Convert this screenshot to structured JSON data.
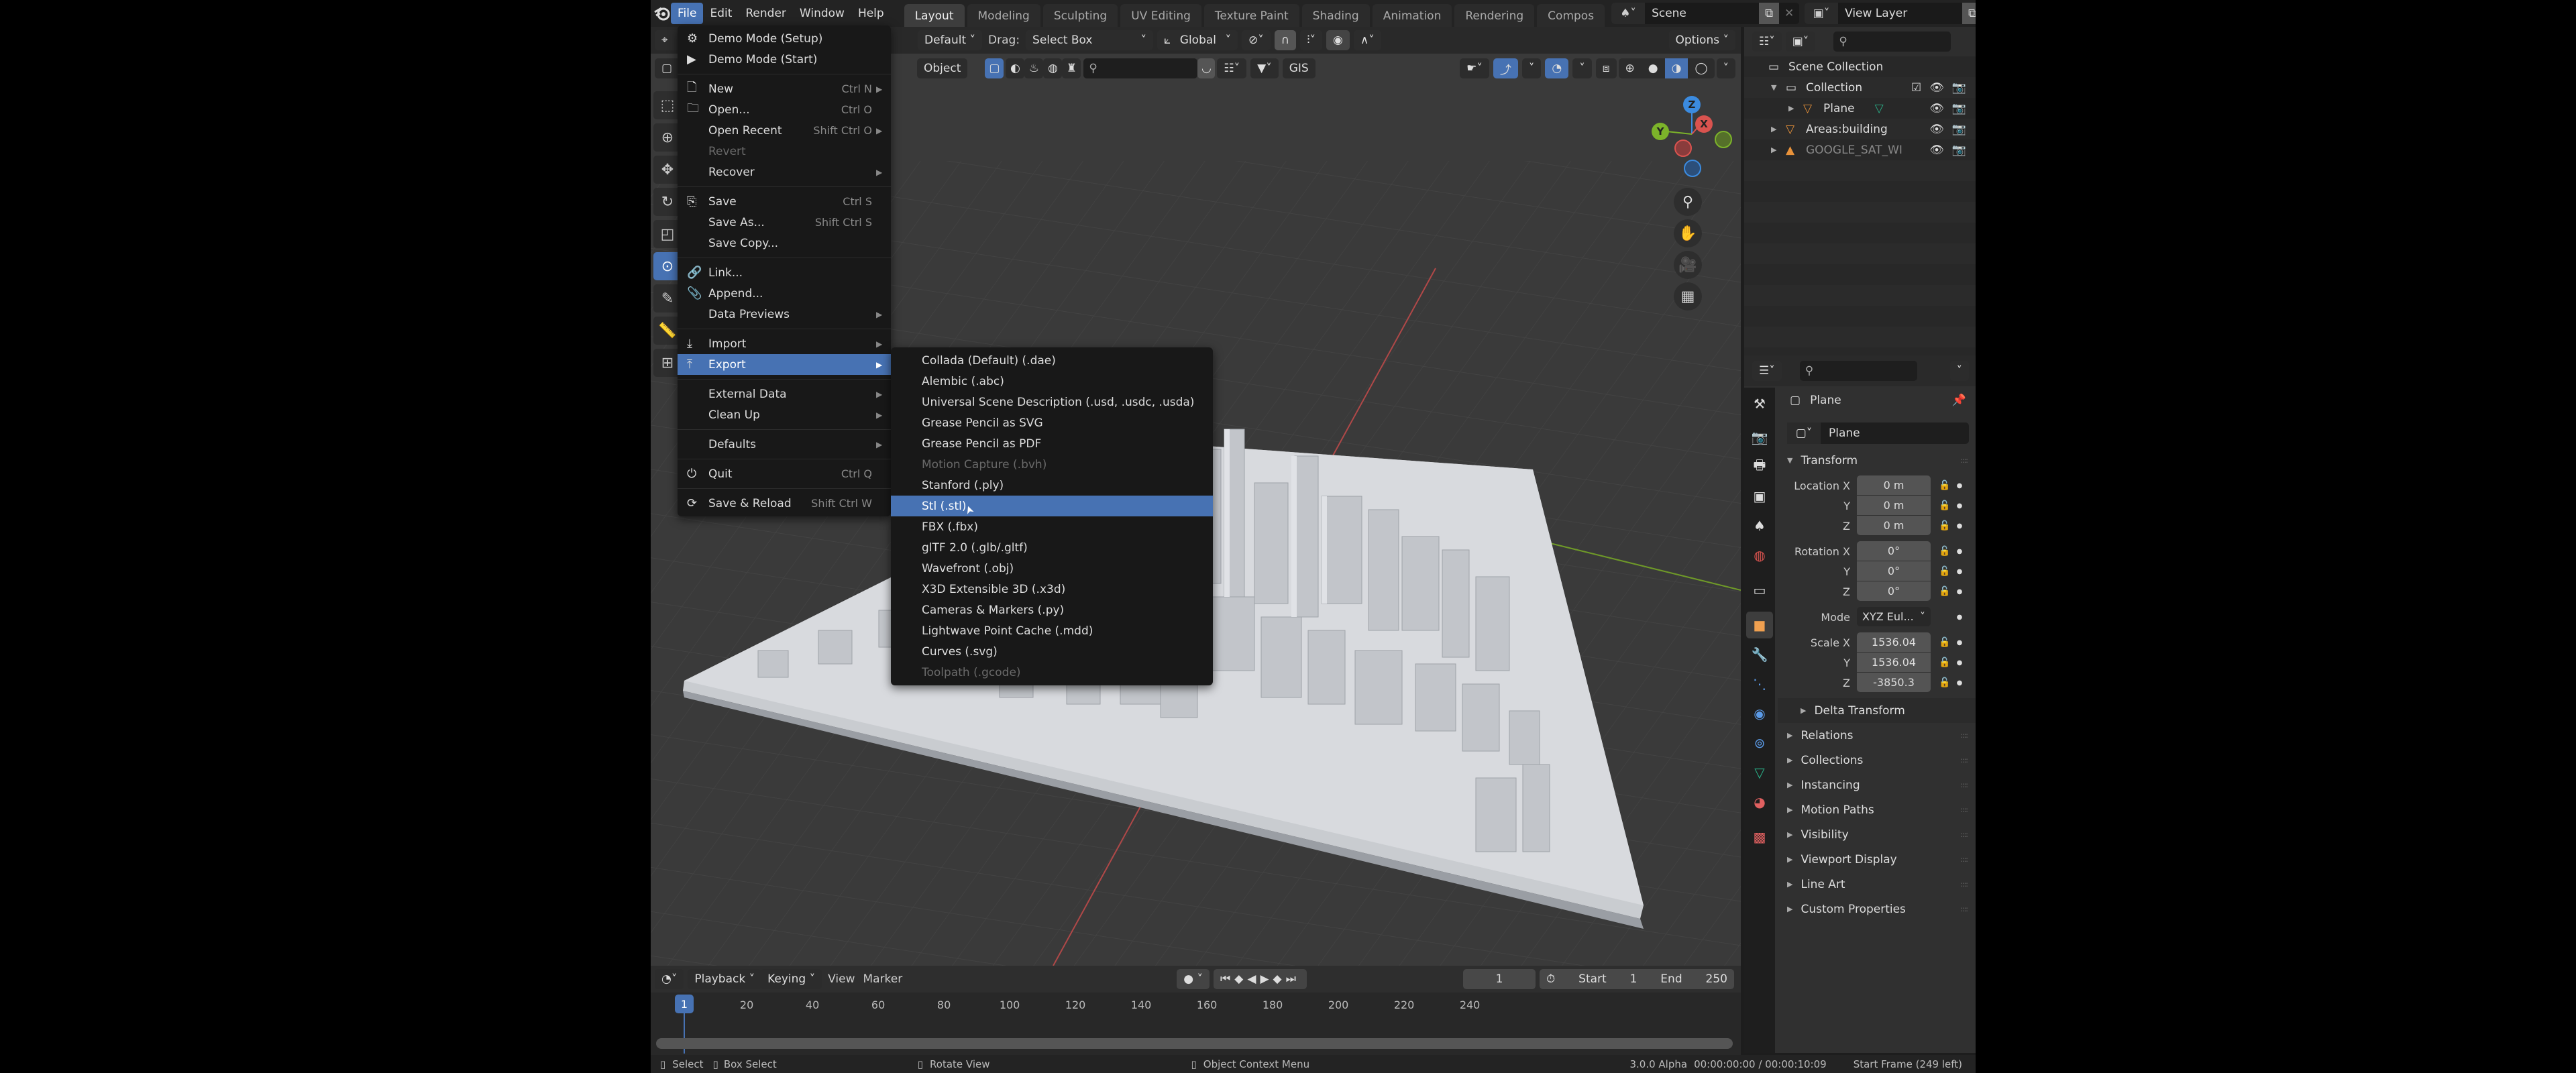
{
  "topbar": {
    "menus": [
      "File",
      "Edit",
      "Render",
      "Window",
      "Help"
    ],
    "active_menu": "File",
    "workspaces": [
      "Layout",
      "Modeling",
      "Sculpting",
      "UV Editing",
      "Texture Paint",
      "Shading",
      "Animation",
      "Rendering",
      "Compos"
    ],
    "active_workspace": "Layout",
    "scene": "Scene",
    "view_layer": "View Layer"
  },
  "viewport_header": {
    "orientation_default": "Default",
    "drag_label": "Drag:",
    "drag_value": "Select Box",
    "transform_orientation": "Global",
    "options_label": "Options",
    "object_menu": "Object",
    "gis_label": "GIS"
  },
  "gizmo": {
    "x": "X",
    "y": "Y",
    "z": "Z"
  },
  "file_menu": {
    "items": [
      {
        "icon": "gear-icon",
        "label": "Demo Mode (Setup)",
        "shortcut": "",
        "submenu": false
      },
      {
        "icon": "play-icon",
        "label": "Demo Mode (Start)",
        "shortcut": "",
        "submenu": false
      },
      {
        "sep": true
      },
      {
        "icon": "new-file-icon",
        "label": "New",
        "shortcut": "Ctrl N",
        "submenu": true
      },
      {
        "icon": "folder-icon",
        "label": "Open...",
        "shortcut": "Ctrl O",
        "submenu": false
      },
      {
        "icon": "",
        "label": "Open Recent",
        "shortcut": "Shift Ctrl O",
        "submenu": true
      },
      {
        "icon": "",
        "label": "Revert",
        "shortcut": "",
        "submenu": false,
        "disabled": true
      },
      {
        "icon": "",
        "label": "Recover",
        "shortcut": "",
        "submenu": true
      },
      {
        "sep": true
      },
      {
        "icon": "save-icon",
        "label": "Save",
        "shortcut": "Ctrl S",
        "submenu": false
      },
      {
        "icon": "",
        "label": "Save As...",
        "shortcut": "Shift Ctrl S",
        "submenu": false
      },
      {
        "icon": "",
        "label": "Save Copy...",
        "shortcut": "",
        "submenu": false
      },
      {
        "sep": true
      },
      {
        "icon": "link-icon",
        "label": "Link...",
        "shortcut": "",
        "submenu": false
      },
      {
        "icon": "paperclip-icon",
        "label": "Append...",
        "shortcut": "",
        "submenu": false
      },
      {
        "icon": "",
        "label": "Data Previews",
        "shortcut": "",
        "submenu": true
      },
      {
        "sep": true
      },
      {
        "icon": "import-icon",
        "label": "Import",
        "shortcut": "",
        "submenu": true
      },
      {
        "icon": "export-icon",
        "label": "Export",
        "shortcut": "",
        "submenu": true,
        "highlighted": true
      },
      {
        "sep": true
      },
      {
        "icon": "",
        "label": "External Data",
        "shortcut": "",
        "submenu": true
      },
      {
        "icon": "",
        "label": "Clean Up",
        "shortcut": "",
        "submenu": true
      },
      {
        "sep": true
      },
      {
        "icon": "",
        "label": "Defaults",
        "shortcut": "",
        "submenu": true
      },
      {
        "sep": true
      },
      {
        "icon": "power-icon",
        "label": "Quit",
        "shortcut": "Ctrl Q",
        "submenu": false
      },
      {
        "sep": true
      },
      {
        "icon": "reload-icon",
        "label": "Save & Reload",
        "shortcut": "Shift Ctrl W",
        "submenu": false
      }
    ]
  },
  "export_menu": {
    "items": [
      {
        "label": "Collada (Default) (.dae)"
      },
      {
        "label": "Alembic (.abc)"
      },
      {
        "label": "Universal Scene Description (.usd, .usdc, .usda)"
      },
      {
        "label": "Grease Pencil as SVG"
      },
      {
        "label": "Grease Pencil as PDF"
      },
      {
        "label": "Motion Capture (.bvh)",
        "disabled": true
      },
      {
        "label": "Stanford (.ply)"
      },
      {
        "label": "Stl (.stl)",
        "highlighted": true
      },
      {
        "label": "FBX (.fbx)"
      },
      {
        "label": "glTF 2.0 (.glb/.gltf)"
      },
      {
        "label": "Wavefront (.obj)"
      },
      {
        "label": "X3D Extensible 3D (.x3d)"
      },
      {
        "label": "Cameras & Markers (.py)"
      },
      {
        "label": "Lightwave Point Cache (.mdd)"
      },
      {
        "label": "Curves (.svg)"
      },
      {
        "label": "Toolpath (.gcode)",
        "disabled": true
      }
    ]
  },
  "outliner": {
    "search_placeholder": "",
    "rows": [
      {
        "label": "Scene Collection",
        "icon": "collection-icon",
        "indent": 0
      },
      {
        "label": "Collection",
        "icon": "collection-icon",
        "indent": 1,
        "expanded": true,
        "checkbox": true
      },
      {
        "label": "Plane",
        "icon": "mesh-object-icon",
        "indent": 2,
        "data_icon": true
      },
      {
        "label": "Areas:building",
        "icon": "mesh-object-icon",
        "indent": 1
      },
      {
        "label": "GOOGLE_SAT_WI",
        "icon": "image-icon",
        "indent": 1,
        "dim": true
      }
    ]
  },
  "properties": {
    "object_name": "Plane",
    "datablock_name": "Plane",
    "transform_title": "Transform",
    "location": {
      "label": "Location",
      "x": "0 m",
      "y": "0 m",
      "z": "0 m"
    },
    "rotation": {
      "label": "Rotation",
      "x": "0°",
      "y": "0°",
      "z": "0°"
    },
    "mode_label": "Mode",
    "mode_value": "XYZ Eul...",
    "scale": {
      "label": "Scale",
      "x": "1536.04",
      "y": "1536.04",
      "z": "-3850.3"
    },
    "delta_transform": "Delta Transform",
    "panels": [
      "Relations",
      "Collections",
      "Instancing",
      "Motion Paths",
      "Visibility",
      "Viewport Display",
      "Line Art",
      "Custom Properties"
    ]
  },
  "timeline": {
    "menus": [
      "Playback",
      "Keying",
      "View",
      "Marker"
    ],
    "current_frame": "1",
    "start_label": "Start",
    "start": "1",
    "end_label": "End",
    "end": "250",
    "ticks": [
      "20",
      "40",
      "60",
      "80",
      "100",
      "120",
      "140",
      "160",
      "180",
      "200",
      "220",
      "240"
    ],
    "playhead": "1"
  },
  "statusbar": {
    "select": "Select",
    "box_select": "Box Select",
    "rotate_view": "Rotate View",
    "context_menu": "Object Context Menu",
    "version": "3.0.0 Alpha",
    "time": "00:00:00:00 / 00:00:10:09",
    "frame_info": "Start Frame (249 left)"
  },
  "colors": {
    "accent": "#4772b3",
    "x_axis": "#d9534f",
    "y_axis": "#7cb32a",
    "z_axis": "#3b8be0"
  }
}
